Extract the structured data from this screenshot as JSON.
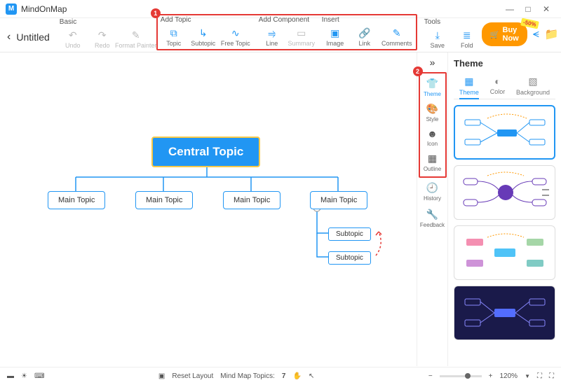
{
  "app": {
    "name": "MindOnMap",
    "logo": "M"
  },
  "window": {
    "min": "—",
    "max": "□",
    "close": "✕"
  },
  "doc": {
    "title": "Untitled",
    "back": "‹"
  },
  "groups": {
    "basic": {
      "label": "Basic",
      "undo": "Undo",
      "redo": "Redo",
      "fpainter": "Format Painter"
    },
    "addtopic": {
      "label": "Add Topic",
      "topic": "Topic",
      "subtopic": "Subtopic",
      "freetopic": "Free Topic"
    },
    "addcomp": {
      "label": "Add Component",
      "line": "Line",
      "summary": "Summary"
    },
    "insert": {
      "label": "Insert",
      "image": "Image",
      "link": "Link",
      "comments": "Comments"
    },
    "tools": {
      "label": "Tools",
      "save": "Save",
      "fold": "Fold"
    }
  },
  "annot": {
    "b1": "1",
    "b2": "2"
  },
  "buy": {
    "label": "Buy Now",
    "discount": "-50%"
  },
  "rail": {
    "theme": "Theme",
    "style": "Style",
    "icon": "Icon",
    "outline": "Outline",
    "history": "History",
    "feedback": "Feedback",
    "collapse": "»"
  },
  "panel": {
    "title": "Theme",
    "tabs": {
      "theme": "Theme",
      "color": "Color",
      "background": "Background"
    }
  },
  "map": {
    "central": "Central Topic",
    "main1": "Main Topic",
    "main2": "Main Topic",
    "main3": "Main Topic",
    "main4": "Main Topic",
    "sub1": "Subtopic",
    "sub2": "Subtopic"
  },
  "status": {
    "reset": "Reset Layout",
    "topics_label": "Mind Map Topics:",
    "topics_count": "7",
    "zoom": "120%",
    "minus": "−",
    "plus": "+"
  }
}
